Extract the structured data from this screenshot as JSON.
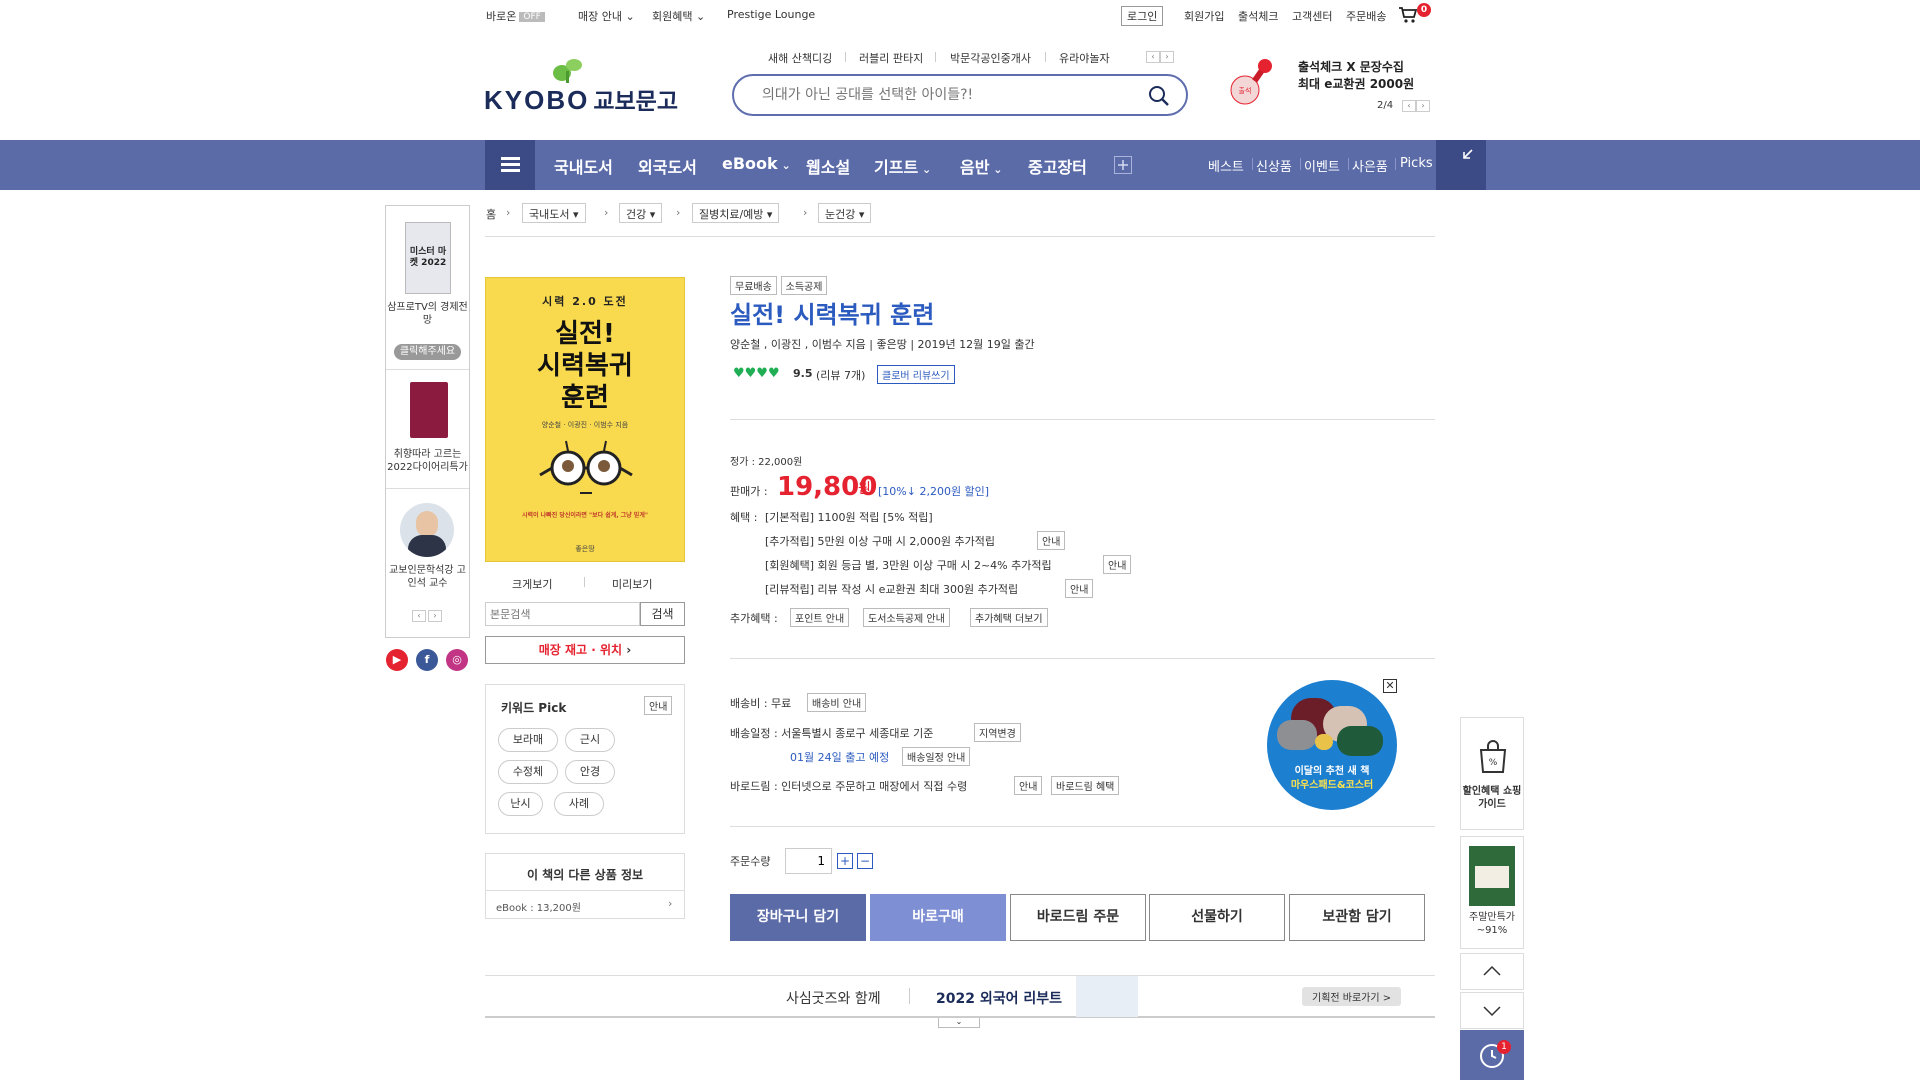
{
  "topbar": {
    "barodrim": "바로온",
    "off": "OFF",
    "store_info": "매장 안내",
    "member_benefit": "회원혜택",
    "prestige": "Prestige Lounge",
    "login": "로그인",
    "join": "회원가입",
    "attendance": "출석체크",
    "customer_center": "고객센터",
    "order_delivery": "주문배송",
    "cart_count": "0"
  },
  "header": {
    "logo_en": "KYOBO",
    "logo_ko": "교보문고",
    "hot_keywords": [
      "새해 산책디깅",
      "러블리 판타지",
      "박문각공인중개사",
      "유라야놀자"
    ],
    "search_placeholder": "의대가 아닌 공대를 선택한 아이들?!",
    "promo_line1": "출석체크 X 문장수집",
    "promo_line2": "최대 e교환권 2000원",
    "promo_page": "2/4"
  },
  "nav": {
    "items": [
      "국내도서",
      "외국도서",
      "eBook",
      "웹소설",
      "기프트",
      "음반",
      "중고장터"
    ],
    "right_items": [
      "베스트",
      "신상품",
      "이벤트",
      "사은품",
      "Picks"
    ]
  },
  "left_sidebar": {
    "item1_label": "삼프로TV의 경제전망",
    "item1_button": "클릭해주세요",
    "item1_cover_text": "미스터 마켓 2022",
    "item2_label": "취향따라 고르는 2022다이어리특가",
    "item3_label": "교보인문학석강 고인석 교수"
  },
  "breadcrumb": {
    "home": "홈",
    "level1": "국내도서",
    "level2": "건강",
    "level3": "질병치료/예방",
    "level4": "눈건강"
  },
  "cover": {
    "top": "시력 2.0 도전",
    "title1": "실전!",
    "title2": "시력복귀",
    "title3": "훈련",
    "authors": "양순철 · 이광진 · 이범수 지음",
    "tagline": "시력이 나빠진 당신이라면 \"보다 쉽게, 그냥 믿게\"",
    "publisher": "좋은땅",
    "enlarge": "크게보기",
    "preview": "미리보기",
    "text_search_placeholder": "본문검색",
    "search_btn": "검색",
    "store_stock": "매장 재고 · 위치"
  },
  "keyword_pick": {
    "title": "키워드 Pick",
    "info": "안내",
    "chips": [
      "보라매",
      "근시",
      "수정체",
      "안경",
      "난시",
      "사례"
    ]
  },
  "other_products": {
    "title": "이 책의 다른 상품 정보",
    "ebook": "eBook : 13,200원"
  },
  "product": {
    "badge1": "무료배송",
    "badge2": "소득공제",
    "title": "실전! 시력복귀 훈련",
    "meta": "양순철 , 이광진 , 이범수 지음 | 좋은땅 | 2019년 12월 19일 출간",
    "rating": "9.5",
    "review_count": "(리뷰 7개)",
    "review_write": "클로버 리뷰쓰기",
    "list_price": "정가 : 22,000원",
    "sale_label": "판매가 :",
    "sale_price": "19,800",
    "sale_unit": "원",
    "discount": "[10%↓ 2,200원 할인]",
    "benefit_label": "혜택 :",
    "benefit1": "[기본적립] 1100원 적립 [5% 적립]",
    "benefit2": "[추가적립] 5만원 이상 구매 시 2,000원 추가적립",
    "benefit3": "[회원혜택] 회원 등급 별, 3만원 이상 구매 시 2~4% 추가적립",
    "benefit4": "[리뷰적립] 리뷰 작성 시 e교환권 최대 300원 추가적립",
    "info": "안내",
    "extra_label": "추가혜택 :",
    "extra1": "포인트 안내",
    "extra2": "도서소득공제 안내",
    "extra3": "추가혜택 더보기",
    "ship_fee": "배송비 : 무료",
    "ship_fee_info": "배송비 안내",
    "ship_schedule": "배송일정 : 서울특별시 종로구 세종대로 기준",
    "region_change": "지역변경",
    "ship_date": "01월 24일 출고 예정",
    "ship_date_info": "배송일정 안내",
    "barodrim": "바로드림 : 인터넷으로 주문하고 매장에서 직접 수령",
    "barodrim_benefit": "바로드림 혜택",
    "qty_label": "주문수량",
    "qty": "1",
    "btn_cart": "장바구니 담기",
    "btn_buy": "바로구매",
    "btn_barodrim": "바로드림 주문",
    "btn_gift": "선물하기",
    "btn_wishlist": "보관함 담기",
    "ad_line1": "이달의 추천 새 책",
    "ad_line2": "마우스패드&코스터"
  },
  "banner": {
    "text1": "사심굿즈와 함께",
    "text2": "2022 외국어 리부트",
    "btn": "기획전 바로가기 >"
  },
  "right_float": {
    "guide": "할인혜택 쇼핑가이드",
    "weekend": "주말만특가 ~91%",
    "recent_count": "1"
  },
  "colors": {
    "brand_navy": "#5b6ba8",
    "price_red": "#e5222f",
    "title_blue": "#2c5bbf"
  }
}
